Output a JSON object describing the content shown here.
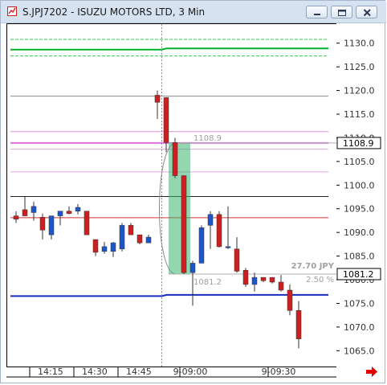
{
  "window": {
    "title": "S.JPJ7202 - ISUZU MOTORS LTD, 3 Min",
    "icons": [
      "app-chart-icon",
      "minimize-icon",
      "maximize-icon",
      "close-icon",
      "scroll-right-arrow-icon"
    ]
  },
  "chart_data": {
    "type": "candlestick",
    "symbol": "S.JPJ7202",
    "interval": "3 Min",
    "y_ticks": [
      "1130.0",
      "1125.0",
      "1120.0",
      "1115.0",
      "1110.0",
      "1105.0",
      "1100.0",
      "1095.0",
      "1090.0",
      "1085.0",
      "1080.0",
      "1075.0",
      "1070.0",
      "1065.0"
    ],
    "y_range": [
      1062,
      1132.5
    ],
    "x_ticks": [
      {
        "label": "14:15",
        "index": 2
      },
      {
        "label": "14:30",
        "index": 7
      },
      {
        "label": "14:45",
        "index": 12
      },
      {
        "label": "9-09:00",
        "index": 19
      },
      {
        "label": "9-09:30",
        "index": 29
      }
    ],
    "session_break_index": 16.5,
    "candles": [
      {
        "o": 1093.5,
        "h": 1094.5,
        "l": 1092,
        "c": 1092.8
      },
      {
        "o": 1094.8,
        "h": 1097.5,
        "l": 1094,
        "c": 1093.5
      },
      {
        "o": 1094.2,
        "h": 1096.5,
        "l": 1092.5,
        "c": 1095.5
      },
      {
        "o": 1093.2,
        "h": 1094,
        "l": 1088.5,
        "c": 1090.5
      },
      {
        "o": 1089.5,
        "h": 1093.5,
        "l": 1088.5,
        "c": 1093.5
      },
      {
        "o": 1093.5,
        "h": 1094.5,
        "l": 1091.5,
        "c": 1094.5
      },
      {
        "o": 1094.5,
        "h": 1095.5,
        "l": 1093.8,
        "c": 1094.0
      },
      {
        "o": 1094.5,
        "h": 1096,
        "l": 1093.8,
        "c": 1095.3
      },
      {
        "o": 1094.5,
        "h": 1094.5,
        "l": 1089.5,
        "c": 1089.5
      },
      {
        "o": 1088.5,
        "h": 1088.5,
        "l": 1085,
        "c": 1085.8
      },
      {
        "o": 1086.0,
        "h": 1088,
        "l": 1085.5,
        "c": 1087.0
      },
      {
        "o": 1086.0,
        "h": 1088,
        "l": 1084.8,
        "c": 1087.8
      },
      {
        "o": 1086.5,
        "h": 1092,
        "l": 1086,
        "c": 1091.5
      },
      {
        "o": 1091.5,
        "h": 1092,
        "l": 1089.5,
        "c": 1089.5
      },
      {
        "o": 1089.5,
        "h": 1089.5,
        "l": 1087.5,
        "c": 1087.8
      },
      {
        "o": 1087.8,
        "h": 1089.5,
        "l": 1087.8,
        "c": 1089.0
      },
      {
        "o": 1119.0,
        "h": 1120,
        "l": 1114,
        "c": 1117.5
      },
      {
        "o": 1118.5,
        "h": 1118.5,
        "l": 1107,
        "c": 1109.0
      },
      {
        "o": 1109.0,
        "h": 1110,
        "l": 1101.5,
        "c": 1102.0
      },
      {
        "o": 1102.0,
        "h": 1102,
        "l": 1081.2,
        "c": 1081.5
      },
      {
        "o": 1081.5,
        "h": 1084,
        "l": 1074.5,
        "c": 1083.5
      },
      {
        "o": 1083.5,
        "h": 1091.5,
        "l": 1083.5,
        "c": 1091.0
      },
      {
        "o": 1091.5,
        "h": 1094.5,
        "l": 1086.5,
        "c": 1093.8
      },
      {
        "o": 1093.8,
        "h": 1094.5,
        "l": 1086.8,
        "c": 1087.0
      },
      {
        "o": 1087.0,
        "h": 1095.5,
        "l": 1086.5,
        "c": 1087.0
      },
      {
        "o": 1086.5,
        "h": 1089,
        "l": 1081.5,
        "c": 1081.8
      },
      {
        "o": 1082.0,
        "h": 1082.5,
        "l": 1078.5,
        "c": 1079.0
      },
      {
        "o": 1079.0,
        "h": 1081.5,
        "l": 1077.5,
        "c": 1080.5
      },
      {
        "o": 1080.5,
        "h": 1080.5,
        "l": 1079.5,
        "c": 1079.8
      },
      {
        "o": 1080.5,
        "h": 1080.5,
        "l": 1079.2,
        "c": 1079.5
      },
      {
        "o": 1079.5,
        "h": 1081,
        "l": 1077.5,
        "c": 1077.8
      },
      {
        "o": 1077.8,
        "h": 1079,
        "l": 1072.5,
        "c": 1073.5
      },
      {
        "o": 1073.5,
        "h": 1075.5,
        "l": 1065.5,
        "c": 1067.5
      }
    ],
    "levels": [
      {
        "price": 1130.8,
        "color": "#2dc84a",
        "style": "dashed",
        "width": 1
      },
      {
        "price": 1128.9,
        "color": "#00b030",
        "style": "solid",
        "width": 2
      },
      {
        "price": 1127.3,
        "color": "#2dc84a",
        "style": "dashed",
        "width": 1
      },
      {
        "price": 1118.8,
        "color": "#8a8a8a",
        "style": "solid",
        "width": 1
      },
      {
        "price": 1111.3,
        "color": "#e090d8",
        "style": "solid",
        "width": 1
      },
      {
        "price": 1108.9,
        "color": "#e070e0",
        "style": "solid",
        "width": 2
      },
      {
        "price": 1107.6,
        "color": "#e8a0e0",
        "style": "solid",
        "width": 1
      },
      {
        "price": 1102.8,
        "color": "#e8a0e0",
        "style": "solid",
        "width": 1
      },
      {
        "price": 1097.6,
        "color": "#202020",
        "style": "solid",
        "width": 1
      },
      {
        "price": 1093.1,
        "color": "#d03030",
        "style": "solid",
        "width": 1
      },
      {
        "price": 1076.8,
        "color": "#1a2bc0",
        "style": "solid",
        "width": 2
      }
    ],
    "price_labels": [
      {
        "text": "1108.9",
        "price": 1108.9
      },
      {
        "text": "1081.2",
        "price": 1081.2
      }
    ],
    "measure": {
      "high_label": "1108.9",
      "low_label": "1081.2",
      "range_label": "27.70 JPY",
      "percent_label": "2.50 %",
      "high": 1108.9,
      "low": 1081.2,
      "start_index": 17,
      "end_index": 19
    },
    "colors": {
      "up": "#1e55c8",
      "down": "#cc1f1f",
      "highlight": "#3cb46e",
      "grid_text": "#333333"
    }
  }
}
